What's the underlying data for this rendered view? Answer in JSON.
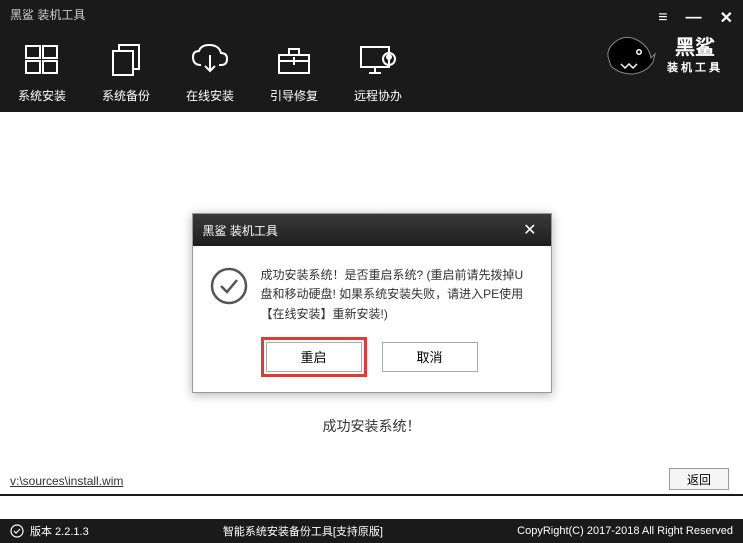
{
  "app_title": "黑鲨 装机工具",
  "nav": {
    "items": [
      {
        "label": "系统安装"
      },
      {
        "label": "系统备份"
      },
      {
        "label": "在线安装"
      },
      {
        "label": "引导修复"
      },
      {
        "label": "远程协办"
      }
    ]
  },
  "brand": {
    "name": "黑鲨",
    "sub": "装机工具"
  },
  "dialog": {
    "title": "黑鲨 装机工具",
    "message": "成功安装系统！是否重启系统? (重启前请先拨掉U盘和移动硬盘! 如果系统安装失败，请进入PE使用【在线安装】重新安装!)",
    "restart_label": "重启",
    "cancel_label": "取消"
  },
  "success_msg": "成功安装系统！",
  "footer": {
    "path": "v:\\sources\\install.wim",
    "back_label": "返回"
  },
  "status": {
    "version": "版本 2.2.1.3",
    "center": "智能系统安装备份工具[支持原版]",
    "right": "CopyRight(C) 2017-2018 All Right Reserved"
  }
}
